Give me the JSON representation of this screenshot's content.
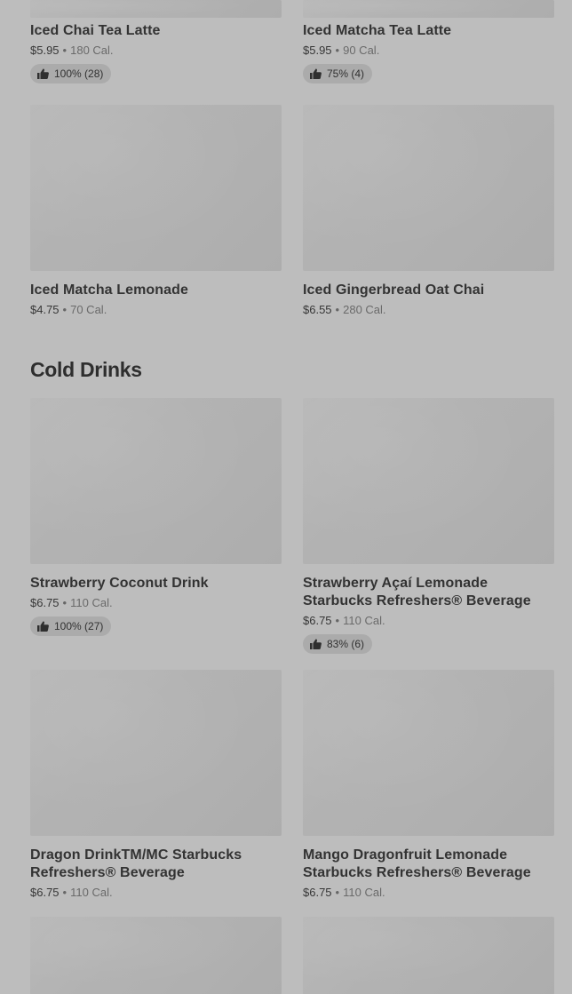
{
  "sections": {
    "cold_drinks_title": "Cold Drinks"
  },
  "items": {
    "iced_chai": {
      "name": "Iced Chai Tea Latte",
      "price": "$5.95",
      "sep": "•",
      "calories": "180 Cal.",
      "rating": "100% (28)"
    },
    "iced_matcha_latte": {
      "name": "Iced Matcha Tea Latte",
      "price": "$5.95",
      "sep": "•",
      "calories": "90 Cal.",
      "rating": "75% (4)"
    },
    "iced_matcha_lemonade": {
      "name": "Iced Matcha Lemonade",
      "price": "$4.75",
      "sep": "•",
      "calories": "70 Cal."
    },
    "iced_gingerbread": {
      "name": "Iced Gingerbread Oat Chai",
      "price": "$6.55",
      "sep": "•",
      "calories": "280 Cal."
    },
    "strawberry_coconut": {
      "name": "Strawberry Coconut Drink",
      "price": "$6.75",
      "sep": "•",
      "calories": "110 Cal.",
      "rating": "100% (27)"
    },
    "strawberry_acai": {
      "name_line1": "Strawberry Açaí Lemonade",
      "name_line2": "Starbucks Refreshers® Beverage",
      "price": "$6.75",
      "sep": "•",
      "calories": "110 Cal.",
      "rating": "83% (6)"
    },
    "dragon_drink": {
      "name_line1": "Dragon DrinkTM/MC Starbucks",
      "name_line2": "Refreshers® Beverage",
      "price": "$6.75",
      "sep": "•",
      "calories": "110 Cal."
    },
    "mango_dragonfruit": {
      "name_line1": "Mango Dragonfruit Lemonade",
      "name_line2": "Starbucks Refreshers® Beverage",
      "price": "$6.75",
      "sep": "•",
      "calories": "110 Cal."
    }
  },
  "icons": {
    "rating": "thumbs-up-icon"
  },
  "colors": {
    "background": "#bdbdbd",
    "image_placeholder": "#b3b3b3",
    "rating_pill": "#ababab",
    "text": "#333333"
  }
}
